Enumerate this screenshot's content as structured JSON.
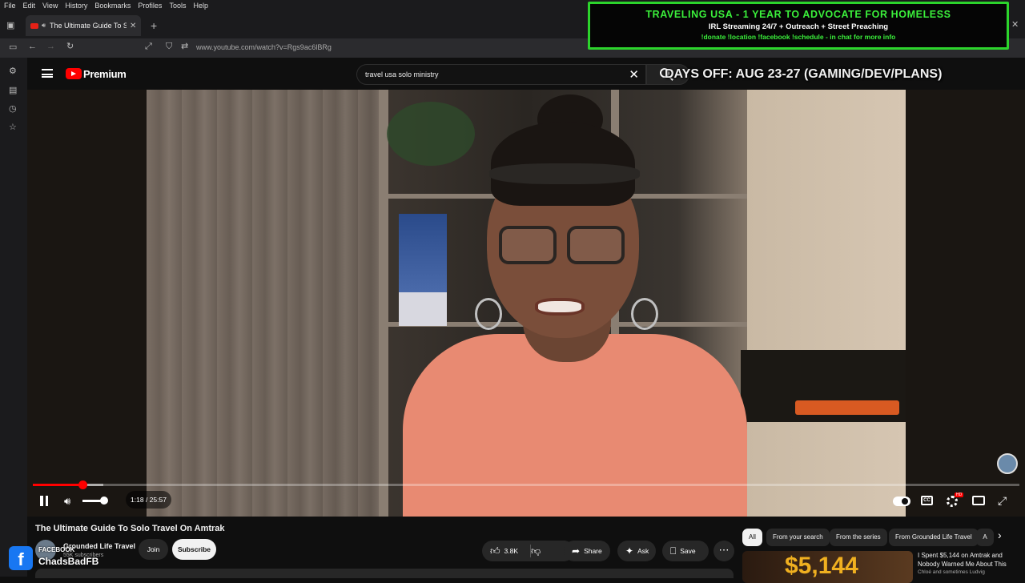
{
  "menubar": {
    "items": [
      "File",
      "Edit",
      "View",
      "History",
      "Bookmarks",
      "Profiles",
      "Tools",
      "Help"
    ]
  },
  "tab": {
    "title": "The Ultimate Guide To Solo Travel On Amtrak"
  },
  "address": {
    "url": "www.youtube.com/watch?v=Rgs9ac6lBRg"
  },
  "overlay": {
    "line1": "TRAVELING USA - 1 YEAR TO ADVOCATE FOR HOMELESS",
    "line2": "IRL Streaming 24/7 + Outreach + Street Preaching",
    "line3": "!donate !location !facebook !schedule - in chat for more info"
  },
  "header": {
    "logo_label": "Premium",
    "search_value": "travel usa solo ministry",
    "days_off": "DAYS OFF:  AUG 23-27 (GAMING/DEV/PLANS)"
  },
  "player": {
    "time": "1:18 / 25:57",
    "progress": 0.05,
    "volume": 0.75
  },
  "video": {
    "title": "The Ultimate Guide To Solo Travel On Amtrak",
    "channel": "Grounded Life Travel",
    "subscribers": "55K subscribers",
    "join_label": "Join",
    "subscribe_label": "Subscribe",
    "likes": "3.8K",
    "share_label": "Share",
    "ask_label": "Ask",
    "save_label": "Save"
  },
  "stream_overlay": {
    "fb_label": "FACEBOOK",
    "fb_name": "ChadsBadFB"
  },
  "chips": [
    "All",
    "From your search",
    "From the series",
    "From Grounded Life Travel",
    "A"
  ],
  "recommended": {
    "thumb_text": "$5,144",
    "title": "I Spent $5,144 on Amtrak and Nobody Warned Me About This",
    "channel": "Chloé and sometimes Ludvig"
  }
}
